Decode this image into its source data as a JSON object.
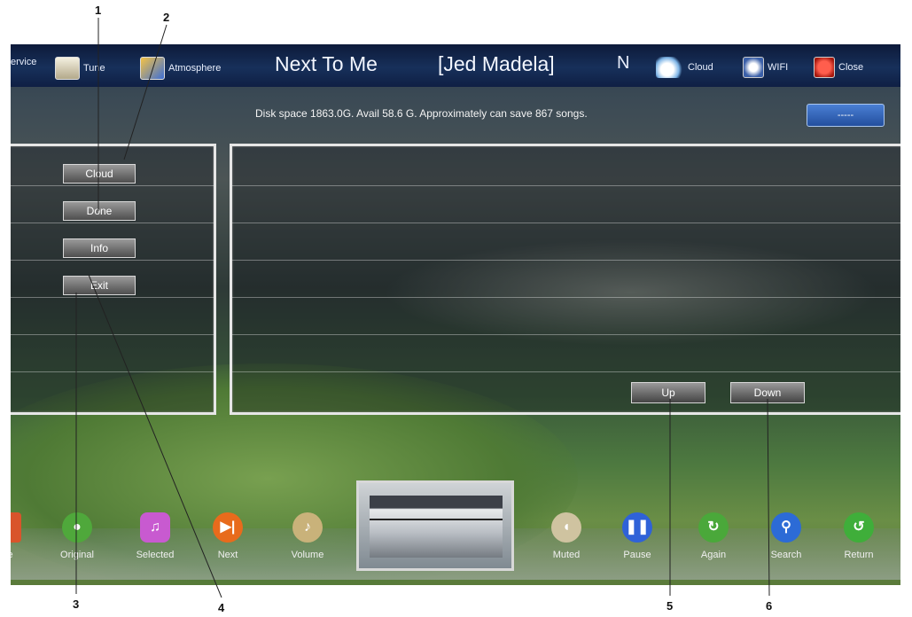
{
  "callouts": [
    "1",
    "2",
    "3",
    "4",
    "5",
    "6"
  ],
  "topbar": {
    "service_label": "ervice",
    "tune_label": "Tune",
    "atmosphere_label": "Atmosphere",
    "song_title": "Next To Me",
    "artist": "[Jed Madela]",
    "mode": "N",
    "cloud_label": "Cloud",
    "wifi_label": "WIFI",
    "close_label": "Close"
  },
  "disk_info": "Disk space 1863.0G. Avail 58.6 G. Approximately can save 867 songs.",
  "status_button": "-----",
  "left_menu": [
    "Cloud",
    "Done",
    "Info",
    "Exit"
  ],
  "list_nav": {
    "up": "Up",
    "down": "Down"
  },
  "bottom_bar": [
    {
      "label": "me",
      "icon": "home-icon",
      "color": "#d9542b"
    },
    {
      "label": "Original",
      "icon": "user-icon",
      "color": "#4fa83b"
    },
    {
      "label": "Selected",
      "icon": "selected-icon",
      "color": "#c85ad0"
    },
    {
      "label": "Next",
      "icon": "next-icon",
      "color": "#e86b1c"
    },
    {
      "label": "Volume",
      "icon": "volume-icon",
      "color": "#c9b27a"
    },
    {
      "label": "Muted",
      "icon": "muted-icon",
      "color": "#cfc3a0"
    },
    {
      "label": "Pause",
      "icon": "pause-icon",
      "color": "#2f62d8"
    },
    {
      "label": "Again",
      "icon": "again-icon",
      "color": "#4aa83a"
    },
    {
      "label": "Search",
      "icon": "search-icon",
      "color": "#2c6bd6"
    },
    {
      "label": "Return",
      "icon": "return-icon",
      "color": "#3fae3a"
    }
  ]
}
